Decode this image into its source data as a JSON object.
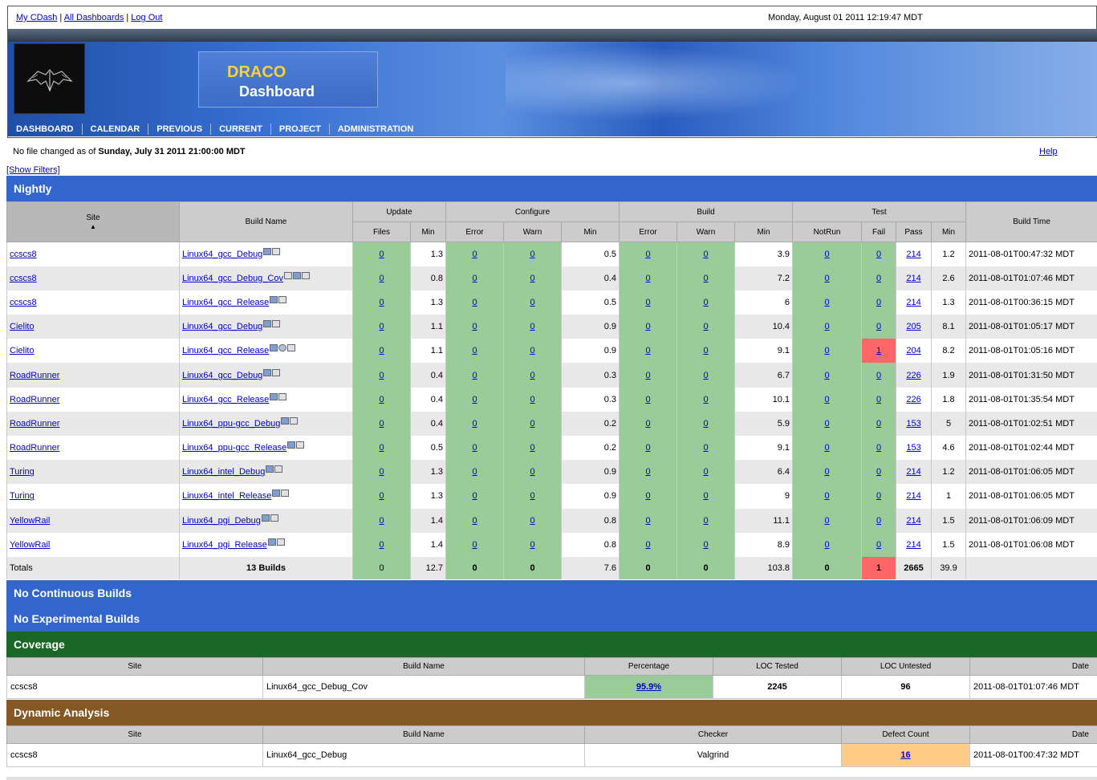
{
  "header": {
    "links": [
      "My CDash",
      "All Dashboards",
      "Log Out"
    ],
    "datetime": "Monday, August 01 2011 12:19:47 MDT",
    "project_name": "DRACO",
    "project_subtitle": "Dashboard",
    "menu": [
      "DASHBOARD",
      "CALENDAR",
      "PREVIOUS",
      "CURRENT",
      "PROJECT",
      "ADMINISTRATION"
    ]
  },
  "info": {
    "nofile_prefix": "No file changed as of",
    "nofile_date": "Sunday, July 31 2011 21:00:00 MDT",
    "help": "Help",
    "show_filters": "[Show Filters]"
  },
  "nightly": {
    "title": "Nightly",
    "group_headers": {
      "update": "Update",
      "configure": "Configure",
      "build": "Build",
      "test": "Test"
    },
    "col_headers": {
      "site": "Site",
      "build_name": "Build Name",
      "update_files": "Files",
      "update_min": "Min",
      "conf_error": "Error",
      "conf_warn": "Warn",
      "conf_min": "Min",
      "build_error": "Error",
      "build_warn": "Warn",
      "build_min": "Min",
      "test_notrun": "NotRun",
      "test_fail": "Fail",
      "test_pass": "Pass",
      "test_min": "Min",
      "build_time": "Build Time"
    },
    "rows": [
      {
        "site": "ccscs8",
        "name": "Linux64_gcc_Debug",
        "icons": [
          "a",
          "b"
        ],
        "uf": "0",
        "um": "1.3",
        "ce": "0",
        "cw": "0",
        "cm": "0.5",
        "be": "0",
        "bw": "0",
        "bm": "3.9",
        "tn": "0",
        "tf": "0",
        "tp": "214",
        "tm": "1.2",
        "time": "2011-08-01T00:47:32 MDT"
      },
      {
        "site": "ccscs8",
        "name": "Linux64_gcc_Debug_Cov",
        "icons": [
          "b",
          "a",
          "b"
        ],
        "uf": "0",
        "um": "0.8",
        "ce": "0",
        "cw": "0",
        "cm": "0.4",
        "be": "0",
        "bw": "0",
        "bm": "7.2",
        "tn": "0",
        "tf": "0",
        "tp": "214",
        "tm": "2.6",
        "time": "2011-08-01T01:07:46 MDT"
      },
      {
        "site": "ccscs8",
        "name": "Linux64_gcc_Release",
        "icons": [
          "a",
          "b"
        ],
        "uf": "0",
        "um": "1.3",
        "ce": "0",
        "cw": "0",
        "cm": "0.5",
        "be": "0",
        "bw": "0",
        "bm": "6",
        "tn": "0",
        "tf": "0",
        "tp": "214",
        "tm": "1.3",
        "time": "2011-08-01T00:36:15 MDT"
      },
      {
        "site": "Cielito",
        "name": "Linux64_gcc_Debug",
        "icons": [
          "a",
          "b"
        ],
        "uf": "0",
        "um": "1.1",
        "ce": "0",
        "cw": "0",
        "cm": "0.9",
        "be": "0",
        "bw": "0",
        "bm": "10.4",
        "tn": "0",
        "tf": "0",
        "tp": "205",
        "tm": "8.1",
        "time": "2011-08-01T01:05:17 MDT"
      },
      {
        "site": "Cielito",
        "name": "Linux64_gcc_Release",
        "icons": [
          "a",
          "c",
          "b"
        ],
        "uf": "0",
        "um": "1.1",
        "ce": "0",
        "cw": "0",
        "cm": "0.9",
        "be": "0",
        "bw": "0",
        "bm": "9.1",
        "tn": "0",
        "tf": "1",
        "tp": "204",
        "tm": "8.2",
        "time": "2011-08-01T01:05:16 MDT"
      },
      {
        "site": "RoadRunner",
        "name": "Linux64_gcc_Debug",
        "icons": [
          "a",
          "b"
        ],
        "uf": "0",
        "um": "0.4",
        "ce": "0",
        "cw": "0",
        "cm": "0.3",
        "be": "0",
        "bw": "0",
        "bm": "6.7",
        "tn": "0",
        "tf": "0",
        "tp": "226",
        "tm": "1.9",
        "time": "2011-08-01T01:31:50 MDT"
      },
      {
        "site": "RoadRunner",
        "name": "Linux64_gcc_Release",
        "icons": [
          "a",
          "b"
        ],
        "uf": "0",
        "um": "0.4",
        "ce": "0",
        "cw": "0",
        "cm": "0.3",
        "be": "0",
        "bw": "0",
        "bm": "10.1",
        "tn": "0",
        "tf": "0",
        "tp": "226",
        "tm": "1.8",
        "time": "2011-08-01T01:35:54 MDT"
      },
      {
        "site": "RoadRunner",
        "name": "Linux64_ppu-gcc_Debug",
        "icons": [
          "a",
          "b"
        ],
        "uf": "0",
        "um": "0.4",
        "ce": "0",
        "cw": "0",
        "cm": "0.2",
        "be": "0",
        "bw": "0",
        "bm": "5.9",
        "tn": "0",
        "tf": "0",
        "tp": "153",
        "tm": "5",
        "time": "2011-08-01T01:02:51 MDT"
      },
      {
        "site": "RoadRunner",
        "name": "Linux64_ppu-gcc_Release",
        "icons": [
          "a",
          "b"
        ],
        "uf": "0",
        "um": "0.5",
        "ce": "0",
        "cw": "0",
        "cm": "0.2",
        "be": "0",
        "bw": "0",
        "bm": "9.1",
        "tn": "0",
        "tf": "0",
        "tp": "153",
        "tm": "4.6",
        "time": "2011-08-01T01:02:44 MDT"
      },
      {
        "site": "Turing",
        "name": "Linux64_intel_Debug",
        "icons": [
          "a",
          "b"
        ],
        "uf": "0",
        "um": "1.3",
        "ce": "0",
        "cw": "0",
        "cm": "0.9",
        "be": "0",
        "bw": "0",
        "bm": "6.4",
        "tn": "0",
        "tf": "0",
        "tp": "214",
        "tm": "1.2",
        "time": "2011-08-01T01:06:05 MDT"
      },
      {
        "site": "Turing",
        "name": "Linux64_intel_Release",
        "icons": [
          "a",
          "b"
        ],
        "uf": "0",
        "um": "1.3",
        "ce": "0",
        "cw": "0",
        "cm": "0.9",
        "be": "0",
        "bw": "0",
        "bm": "9",
        "tn": "0",
        "tf": "0",
        "tp": "214",
        "tm": "1",
        "time": "2011-08-01T01:06:05 MDT"
      },
      {
        "site": "YellowRail",
        "name": "Linux64_pgi_Debug",
        "icons": [
          "a",
          "b"
        ],
        "uf": "0",
        "um": "1.4",
        "ce": "0",
        "cw": "0",
        "cm": "0.8",
        "be": "0",
        "bw": "0",
        "bm": "11.1",
        "tn": "0",
        "tf": "0",
        "tp": "214",
        "tm": "1.5",
        "time": "2011-08-01T01:06:09 MDT"
      },
      {
        "site": "YellowRail",
        "name": "Linux64_pgi_Release",
        "icons": [
          "a",
          "b"
        ],
        "uf": "0",
        "um": "1.4",
        "ce": "0",
        "cw": "0",
        "cm": "0.8",
        "be": "0",
        "bw": "0",
        "bm": "8.9",
        "tn": "0",
        "tf": "0",
        "tp": "214",
        "tm": "1.5",
        "time": "2011-08-01T01:06:08 MDT"
      }
    ],
    "totals": {
      "label": "Totals",
      "builds": "13 Builds",
      "uf": "0",
      "um": "12.7",
      "ce": "0",
      "cw": "0",
      "cm": "7.6",
      "be": "0",
      "bw": "0",
      "bm": "103.8",
      "tn": "0",
      "tf": "1",
      "tp": "2665",
      "tm": "39.9"
    }
  },
  "continuous": {
    "title": "No Continuous Builds"
  },
  "experimental": {
    "title": "No Experimental Builds"
  },
  "coverage": {
    "title": "Coverage",
    "headers": {
      "site": "Site",
      "build_name": "Build Name",
      "percentage": "Percentage",
      "loc_tested": "LOC Tested",
      "loc_untested": "LOC Untested",
      "date": "Date"
    },
    "row": {
      "site": "ccscs8",
      "build_name": "Linux64_gcc_Debug_Cov",
      "percentage": "95.9%",
      "loc_tested": "2245",
      "loc_untested": "96",
      "date": "2011-08-01T01:07:46 MDT"
    }
  },
  "dynamic": {
    "title": "Dynamic Analysis",
    "headers": {
      "site": "Site",
      "build_name": "Build Name",
      "checker": "Checker",
      "defect_count": "Defect Count",
      "date": "Date"
    },
    "row": {
      "site": "ccscs8",
      "build_name": "Linux64_gcc_Debug",
      "checker": "Valgrind",
      "defect_count": "16",
      "date": "2011-08-01T00:47:32 MDT"
    }
  }
}
